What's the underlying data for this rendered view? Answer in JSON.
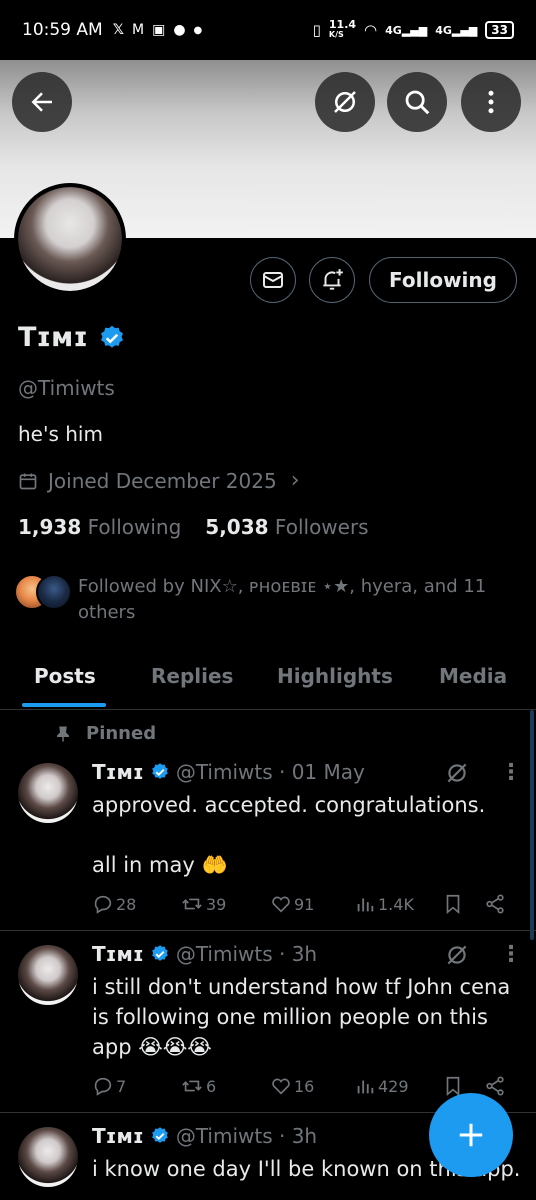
{
  "status_bar": {
    "time": "10:59 AM",
    "net_speed": "11.4",
    "net_unit": "K/S",
    "net1": "4G",
    "net2": "4G",
    "battery": "33"
  },
  "profile": {
    "name": "Tɪмɪ",
    "handle": "@Timiwts",
    "bio": "he's him",
    "joined": "Joined December 2025",
    "following_count": "1,938",
    "following_label": "Following",
    "followers_count": "5,038",
    "followers_label": "Followers",
    "followed_by": "Followed by NIX☆, ᴘʜᴏᴇʙɪᴇ ⋆★, hyera, and 11 others",
    "follow_button": "Following"
  },
  "tabs": [
    {
      "label": "Posts",
      "active": true
    },
    {
      "label": "Replies"
    },
    {
      "label": "Highlights"
    },
    {
      "label": "Media"
    }
  ],
  "posts": [
    {
      "pinned_label": "Pinned",
      "name": "Tɪмɪ",
      "meta": "@Timiwts · 01 May",
      "text1": "approved. accepted. congratulations.",
      "text2": "all in may 🤲",
      "replies": "28",
      "reposts": "39",
      "likes": "91",
      "views": "1.4K"
    },
    {
      "name": "Tɪмɪ",
      "meta": "@Timiwts · 3h",
      "text1": "i still don't understand how tf John cena is following one million people on this app 😭😭😭",
      "replies": "7",
      "reposts": "6",
      "likes": "16",
      "views": "429"
    },
    {
      "name": "Tɪмɪ",
      "meta": "@Timiwts · 3h",
      "text1": "i know one day I'll be known on this app."
    }
  ],
  "colors": {
    "accent": "#1d9bf0",
    "secondary_text": "#71767b",
    "divider": "#2f3336"
  }
}
